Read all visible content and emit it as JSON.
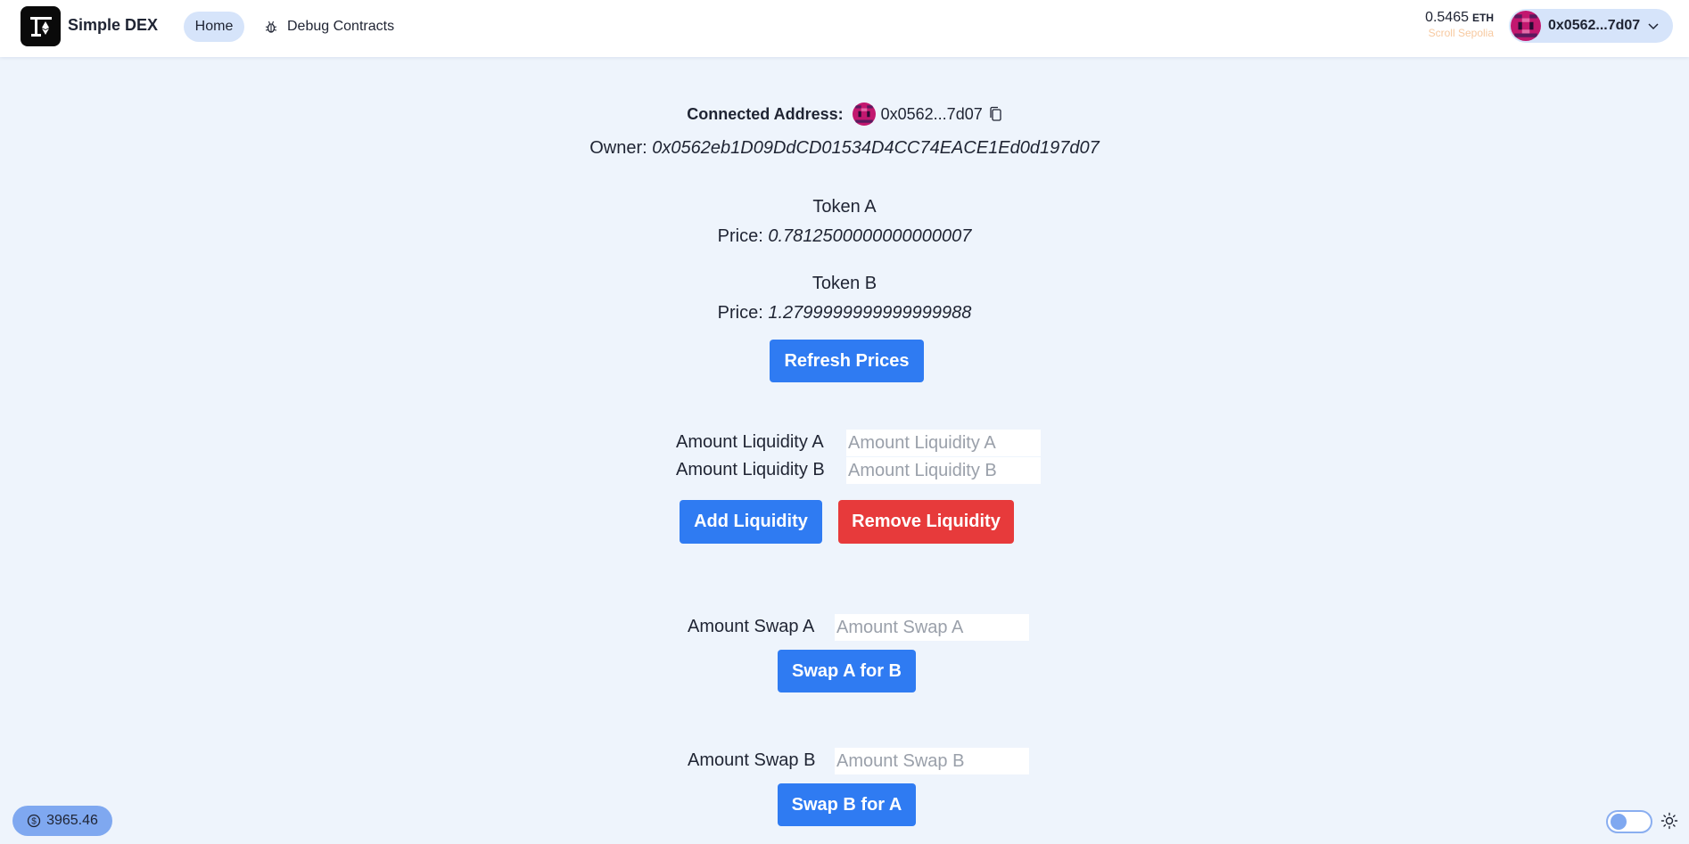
{
  "header": {
    "brand": "Simple DEX",
    "nav": {
      "home": "Home",
      "debug": "Debug Contracts"
    },
    "balance": {
      "amount": "0.5465",
      "unit": "ETH",
      "network": "Scroll Sepolia"
    },
    "account": {
      "address": "0x0562...7d07"
    }
  },
  "main": {
    "connected": {
      "label": "Connected Address:",
      "address": "0x0562...7d07"
    },
    "owner": {
      "label": "Owner:",
      "value": "0x0562eb1D09DdCD01534D4CC74EACE1Ed0d197d07"
    },
    "tokenA": {
      "name": "Token A",
      "price_label": "Price:",
      "price": "0.7812500000000000007"
    },
    "tokenB": {
      "name": "Token B",
      "price_label": "Price:",
      "price": "1.2799999999999999988"
    },
    "refresh_button": "Refresh Prices",
    "liquidity": {
      "a_label": "Amount Liquidity A",
      "a_placeholder": "Amount Liquidity A",
      "b_label": "Amount Liquidity B",
      "b_placeholder": "Amount Liquidity B",
      "add_button": "Add Liquidity",
      "remove_button": "Remove Liquidity"
    },
    "swapA": {
      "label": "Amount Swap A",
      "placeholder": "Amount Swap A",
      "button": "Swap A for B"
    },
    "swapB": {
      "label": "Amount Swap B",
      "placeholder": "Amount Swap B",
      "button": "Swap B for A"
    }
  },
  "footer": {
    "eth_price": "3965.46"
  },
  "colors": {
    "background": "#eef4fc",
    "primary": "#2f7bf2",
    "danger": "#e73a3b",
    "nav_active": "#d6e4fa",
    "network": "#f7c9a0"
  }
}
